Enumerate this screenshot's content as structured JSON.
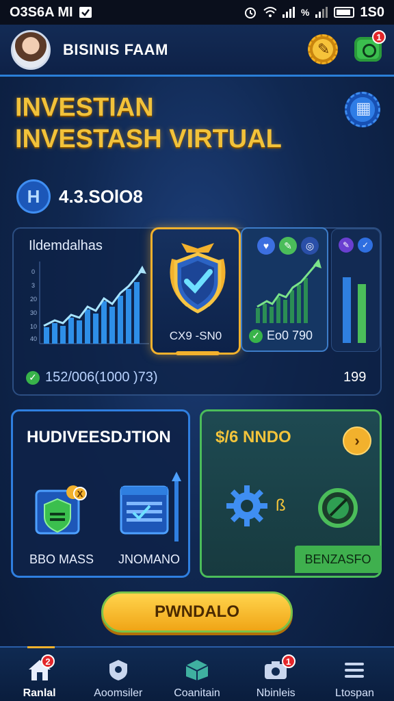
{
  "status_bar": {
    "left_text": "O3S6A MI",
    "right_text": "1S0",
    "signal_text": "%"
  },
  "header": {
    "title": "BISINIS FAAM",
    "notification_count": "1"
  },
  "hero": {
    "title": "INVESTIAN INVESTASH VIRTUAL",
    "balance_icon_text": "H",
    "balance": "4.3.SOlO8"
  },
  "overview_panel": {
    "label": "Ildemdalhas",
    "axis_ticks": [
      "0",
      "3",
      "20",
      "30",
      "10",
      "40"
    ],
    "footer_text": "152/006(1000 )73)",
    "right_value": "199"
  },
  "shield_card": {
    "code": "CX9 -SN0"
  },
  "growth_card": {
    "footer_text": "Eo0 790"
  },
  "tiles": {
    "left": {
      "title": "HUDIVEESDJTION",
      "caption_a": "BBO MASS",
      "caption_b": "JNOMANO",
      "icon_badge": "X"
    },
    "right": {
      "title": "$/6 NNDO",
      "go_label": "›",
      "mid_mark": "ß",
      "strip_label": "BENZASFO"
    }
  },
  "cta": {
    "label": "PWNDALO"
  },
  "tabbar": {
    "items": [
      {
        "label": "Ranlal",
        "badge": "2"
      },
      {
        "label": "Aoomsiler",
        "badge": ""
      },
      {
        "label": "Coanitain",
        "badge": ""
      },
      {
        "label": "Nbinleis",
        "badge": "1"
      },
      {
        "label": "Ltospan",
        "badge": ""
      }
    ]
  },
  "colors": {
    "accent_gold": "#f2b12d",
    "accent_blue": "#2f7fe0",
    "accent_green": "#4bbd5a",
    "badge_red": "#e3262a"
  }
}
